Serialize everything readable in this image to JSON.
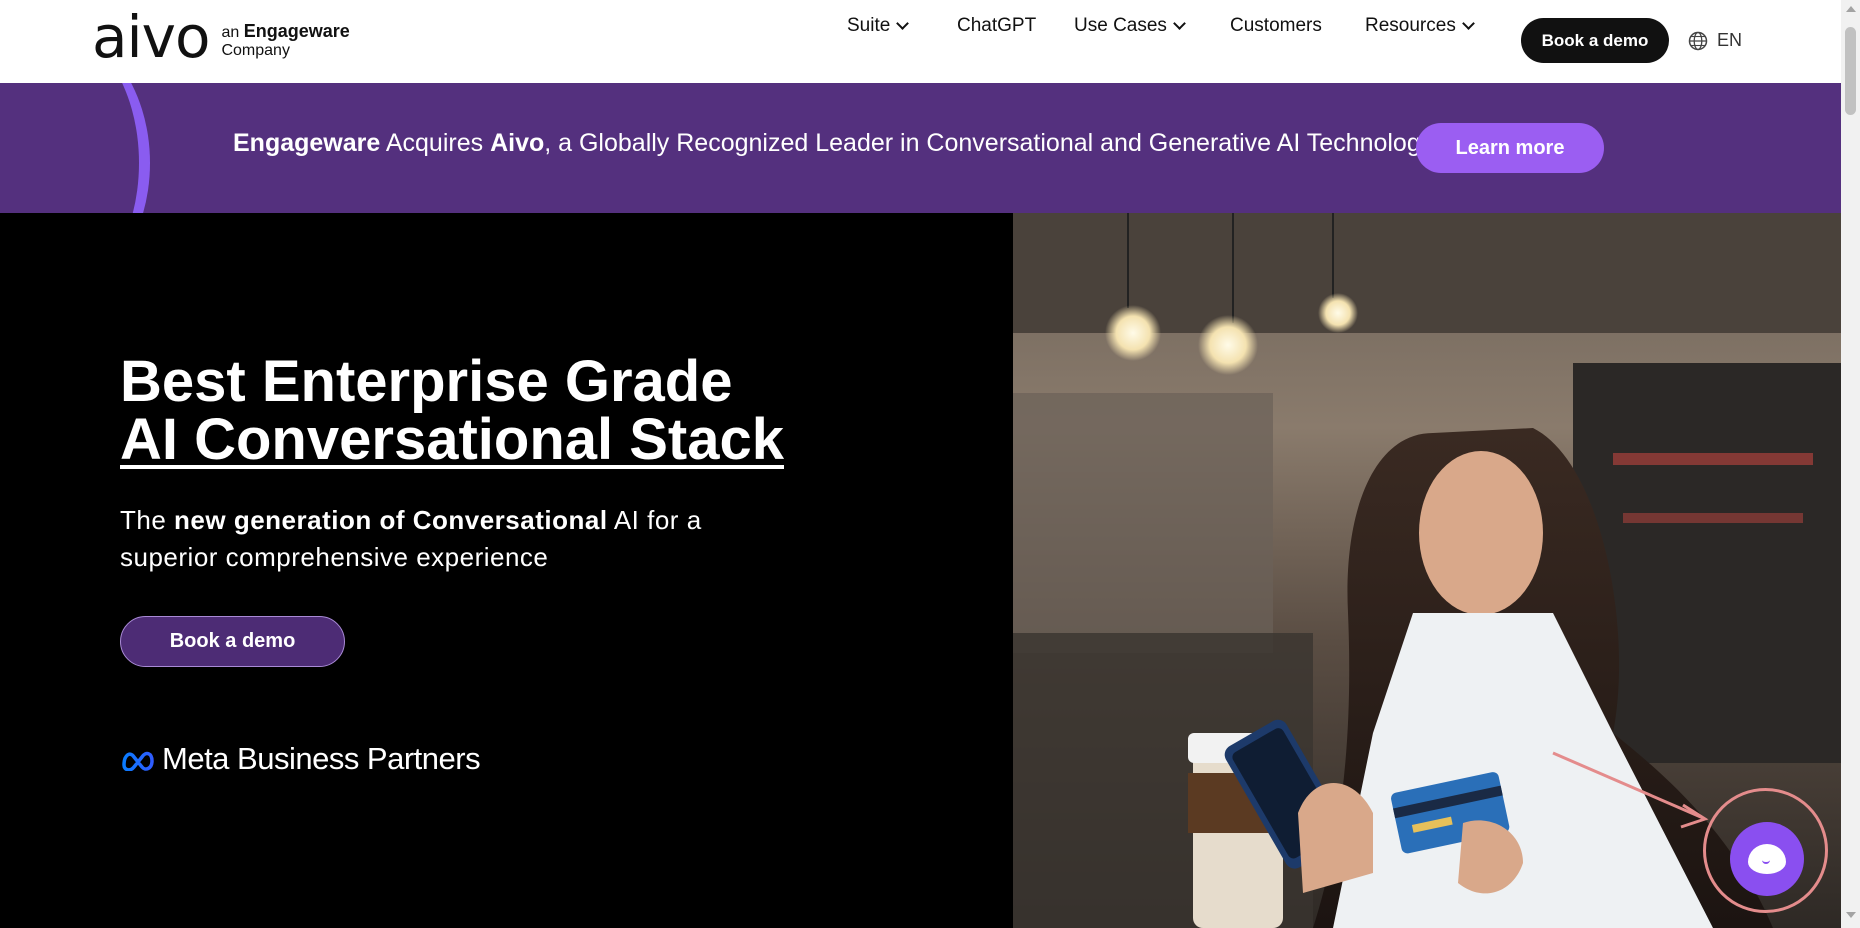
{
  "header": {
    "logo_text": "aivo",
    "logo_tag_prefix": "an",
    "logo_tag_brand": "Engageware",
    "logo_tag_suffix": "Company",
    "nav": {
      "suite": "Suite",
      "chatgpt": "ChatGPT",
      "use_cases": "Use Cases",
      "customers": "Customers",
      "resources": "Resources"
    },
    "cta": "Book a demo",
    "language": "EN",
    "icons": [
      "chevron-down-icon",
      "globe-icon"
    ]
  },
  "banner": {
    "brand1": "Engageware",
    "mid": " Acquires ",
    "brand2": "Aivo",
    "rest": ", a Globally Recognized Leader in Conversational and Generative AI Technology",
    "cta": "Learn more"
  },
  "hero": {
    "title_line1": "Best Enterprise Grade",
    "title_line2": "AI Conversational Stack",
    "sub_prefix": "The ",
    "sub_bold": "new generation of Conversational",
    "sub_rest": " AI for a superior comprehensive experience",
    "cta": "Book a demo",
    "partner": "Meta Business Partners"
  },
  "chat_widget": {
    "icon": "chat-bubble-icon"
  },
  "colors": {
    "banner_bg": "#54307e",
    "learn_more": "#9b5ef2",
    "hero_cta": "#4d2c75",
    "chat": "#8a4ff0"
  }
}
